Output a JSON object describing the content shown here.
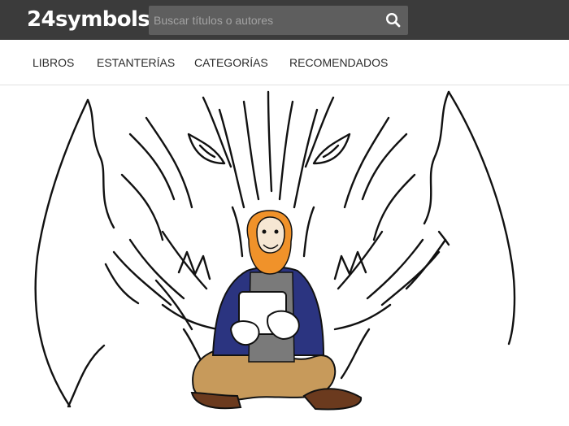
{
  "header": {
    "logo_text": "24symbols",
    "search": {
      "placeholder": "Buscar títulos o autores",
      "icon": "search-icon"
    }
  },
  "nav": {
    "items": [
      {
        "label": "LIBROS"
      },
      {
        "label": "ESTANTERÍAS"
      },
      {
        "label": "CATEGORÍAS"
      },
      {
        "label": "RECOMENDADOS"
      }
    ]
  },
  "colors": {
    "topbar": "#3b3b3b",
    "search_bg": "#5e5e5e",
    "hair": "#f0922a",
    "jacket": "#2b3480",
    "pants": "#c79a5b",
    "shoes": "#6b3a1e"
  }
}
